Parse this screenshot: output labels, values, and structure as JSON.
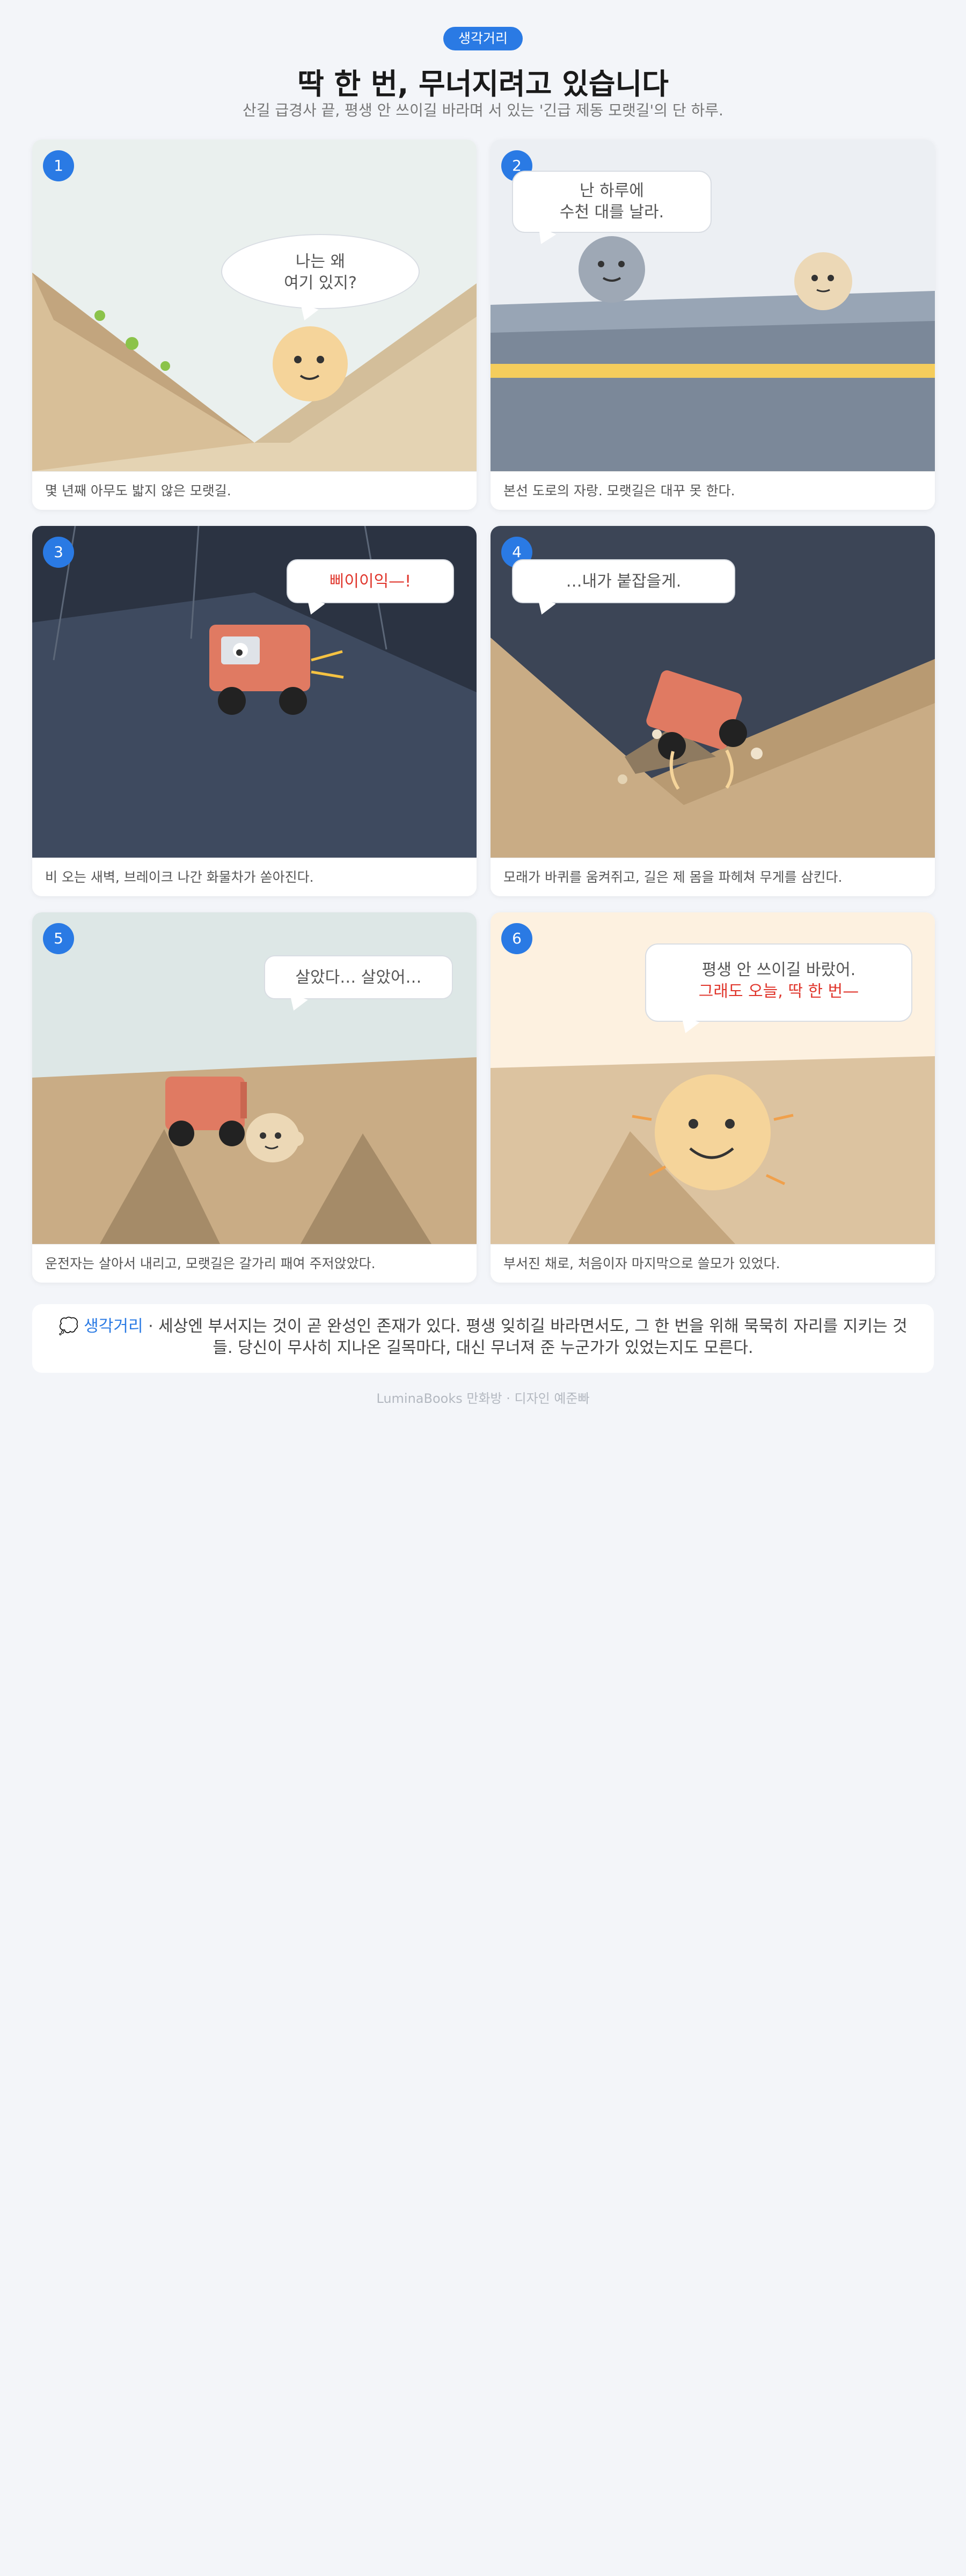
{
  "header": {
    "badge": "생각거리",
    "title": "딱 한 번, 무너지려고 있습니다",
    "subtitle": "산길 급경사 끝, 평생 안 쓰이길 바라며 서 있는 '긴급 제동 모랫길'의 단 하루."
  },
  "panels": [
    {
      "number": "1",
      "bubble": [
        "나는 왜",
        "여기 있지?"
      ],
      "caption": "몇 년째 아무도 밟지 않은 모랫길."
    },
    {
      "number": "2",
      "bubble": [
        "난 하루에",
        "수천 대를 날라."
      ],
      "caption": "본선 도로의 자랑. 모랫길은 대꾸 못 한다."
    },
    {
      "number": "3",
      "bubble": [
        "삐이이익—!"
      ],
      "caption": "비 오는 새벽, 브레이크 나간 화물차가 쏟아진다."
    },
    {
      "number": "4",
      "bubble": [
        "…내가 붙잡을게."
      ],
      "caption": "모래가 바퀴를 움켜쥐고, 길은 제 몸을 파헤쳐 무게를 삼킨다."
    },
    {
      "number": "5",
      "bubble": [
        "살았다… 살았어…"
      ],
      "caption": "운전자는 살아서 내리고, 모랫길은 갈가리 패여 주저앉았다."
    },
    {
      "number": "6",
      "bubble": [
        "평생 안 쓰이길 바랐어.",
        "그래도 오늘, 딱 한 번—"
      ],
      "caption": "부서진 채로, 처음이자 마지막으로 쓸모가 있었다."
    }
  ],
  "note": {
    "icon": "speech-bubble-icon",
    "tag": "생각거리",
    "separator": " · ",
    "text": "세상엔 부서지는 것이 곧 완성인 존재가 있다. 평생 잊히길 바라면서도, 그 한 번을 위해 묵묵히 자리를 지키는 것들. 당신이 무사히 지나온 길목마다, 대신 무너져 준 누군가가 있었는지도 모른다."
  },
  "footer": "LuminaBooks 만화방 · 디자인 예준빠",
  "colors": {
    "accent": "#2a7ae4",
    "alert": "#e0362c",
    "sand": "#c9ac85",
    "truck": "#e07a62",
    "night": "#2e3748"
  }
}
